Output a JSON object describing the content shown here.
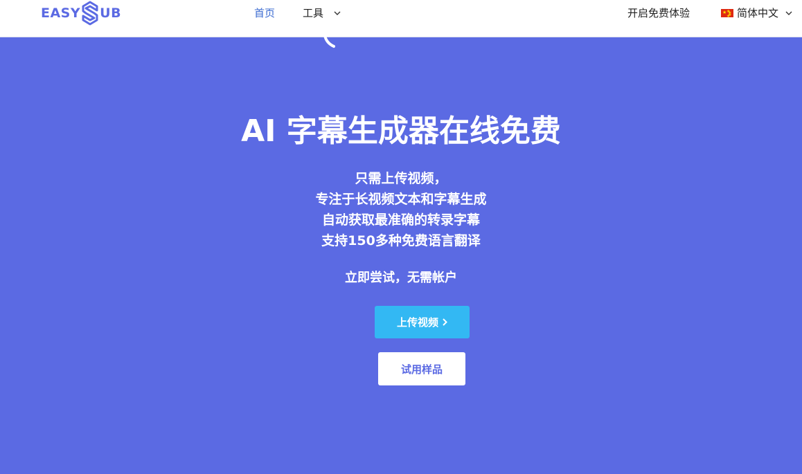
{
  "brand": {
    "logo_left": "EASY",
    "logo_right": "UB",
    "color": "#5b6ae3",
    "icon": "s-logo-icon"
  },
  "nav": {
    "home": "首页",
    "tools": "工具",
    "free_trial": "开启免费体验",
    "language": "简体中文",
    "language_flag": "cn-flag-icon",
    "active_color": "#3b6bd1"
  },
  "hero": {
    "title": "AI 字幕生成器在线免费",
    "lines": [
      "只需上传视频，",
      "专注于长视频文本和字幕生成",
      "自动获取最准确的转录字幕",
      "支持150多种免费语言翻译"
    ],
    "note": "立即尝试，无需帐户",
    "background": "#5b6ae3"
  },
  "actions": {
    "upload": "上传视频",
    "sample": "试用样品",
    "upload_color": "#33b8f3"
  }
}
